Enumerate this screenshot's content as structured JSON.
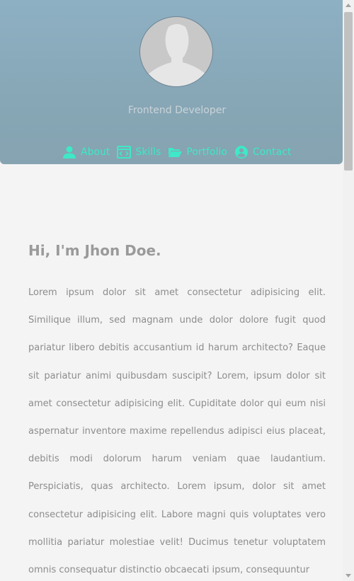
{
  "profile": {
    "role": "Frontend Developer"
  },
  "nav": {
    "items": [
      {
        "label": "About",
        "icon": "user-icon"
      },
      {
        "label": "Skills",
        "icon": "code-icon"
      },
      {
        "label": "Portfolio",
        "icon": "folder-open-icon"
      },
      {
        "label": "Contact",
        "icon": "user-circle-icon"
      }
    ]
  },
  "about": {
    "greeting": "Hi, I'm Jhon Doe.",
    "bio": "Lorem ipsum dolor sit amet consectetur adipisicing elit. Similique illum, sed magnam unde dolor dolore fugit quod pariatur libero debitis accusantium id harum architecto? Eaque sit pariatur animi quibusdam suscipit? Lorem, ipsum dolor sit amet consectetur adipisicing elit. Cupiditate dolor qui eum nisi aspernatur inventore maxime repellendus adipisci eius placeat, debitis modi dolorum harum veniam quae laudantium. Perspiciatis, quas architecto. Lorem ipsum, dolor sit amet consectetur adipisicing elit. Labore magni quis voluptates vero mollitia pariatur molestiae velit! Ducimus tenetur voluptatem omnis consequatur distinctio obcaecati ipsum, consequuntur"
  },
  "colors": {
    "accent": "#3ee8c8",
    "hero": "#8aabbd",
    "background": "#f4f4f4"
  }
}
